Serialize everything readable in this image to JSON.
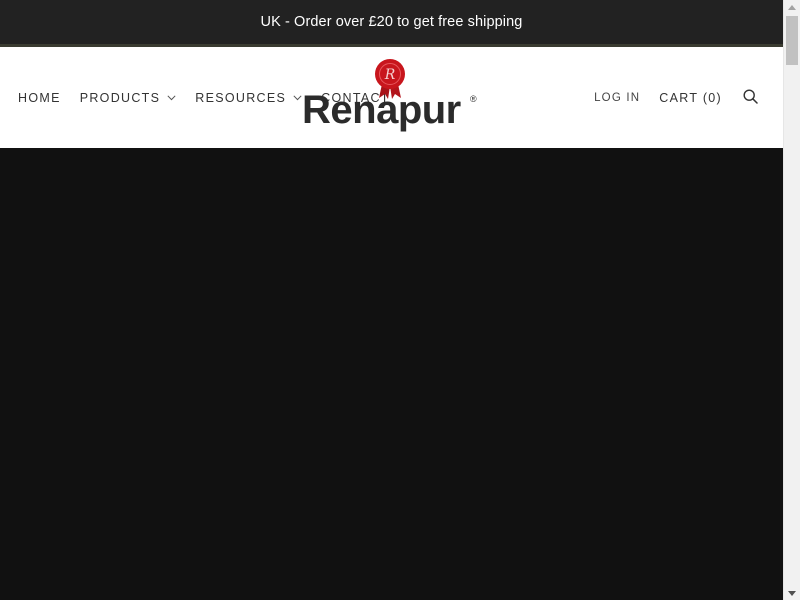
{
  "announcement": {
    "text": "UK - Order over £20 to get free shipping"
  },
  "header": {
    "nav_left": [
      {
        "label": "HOME",
        "has_dropdown": false
      },
      {
        "label": "PRODUCTS",
        "has_dropdown": true
      },
      {
        "label": "RESOURCES",
        "has_dropdown": true
      },
      {
        "label": "CONTACT",
        "has_dropdown": false
      }
    ],
    "logo": {
      "brand": "Renapur",
      "registered_mark": "®",
      "seal_letter": "R",
      "seal_color": "#c8161d"
    },
    "nav_right": {
      "login_label": "LOG IN",
      "cart_label": "CART (0)",
      "search_icon": "search-icon"
    }
  },
  "colors": {
    "announcement_bg": "#222222",
    "announcement_underline": "#3a3b30",
    "hero_bg": "#111111",
    "nav_text": "#333333"
  }
}
